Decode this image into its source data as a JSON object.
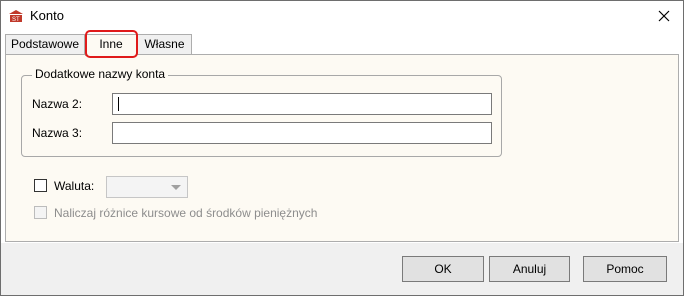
{
  "window": {
    "title": "Konto"
  },
  "tabs": [
    {
      "label": "Podstawowe",
      "active": false
    },
    {
      "label": "Inne",
      "active": true
    },
    {
      "label": "Własne",
      "active": false
    }
  ],
  "group": {
    "title": "Dodatkowe nazwy konta",
    "fields": [
      {
        "label": "Nazwa 2:",
        "value": ""
      },
      {
        "label": "Nazwa 3:",
        "value": ""
      }
    ]
  },
  "currency": {
    "label": "Waluta:",
    "checked": false,
    "selected": ""
  },
  "exchange": {
    "label": "Naliczaj różnice kursowe od środków pieniężnych",
    "checked": false,
    "enabled": false
  },
  "buttons": {
    "ok": "OK",
    "cancel": "Anuluj",
    "help": "Pomoc"
  },
  "colors": {
    "panel_bg": "#fdfaf3",
    "highlight": "#e01a1a",
    "footer_bg": "#f0f0f0"
  }
}
